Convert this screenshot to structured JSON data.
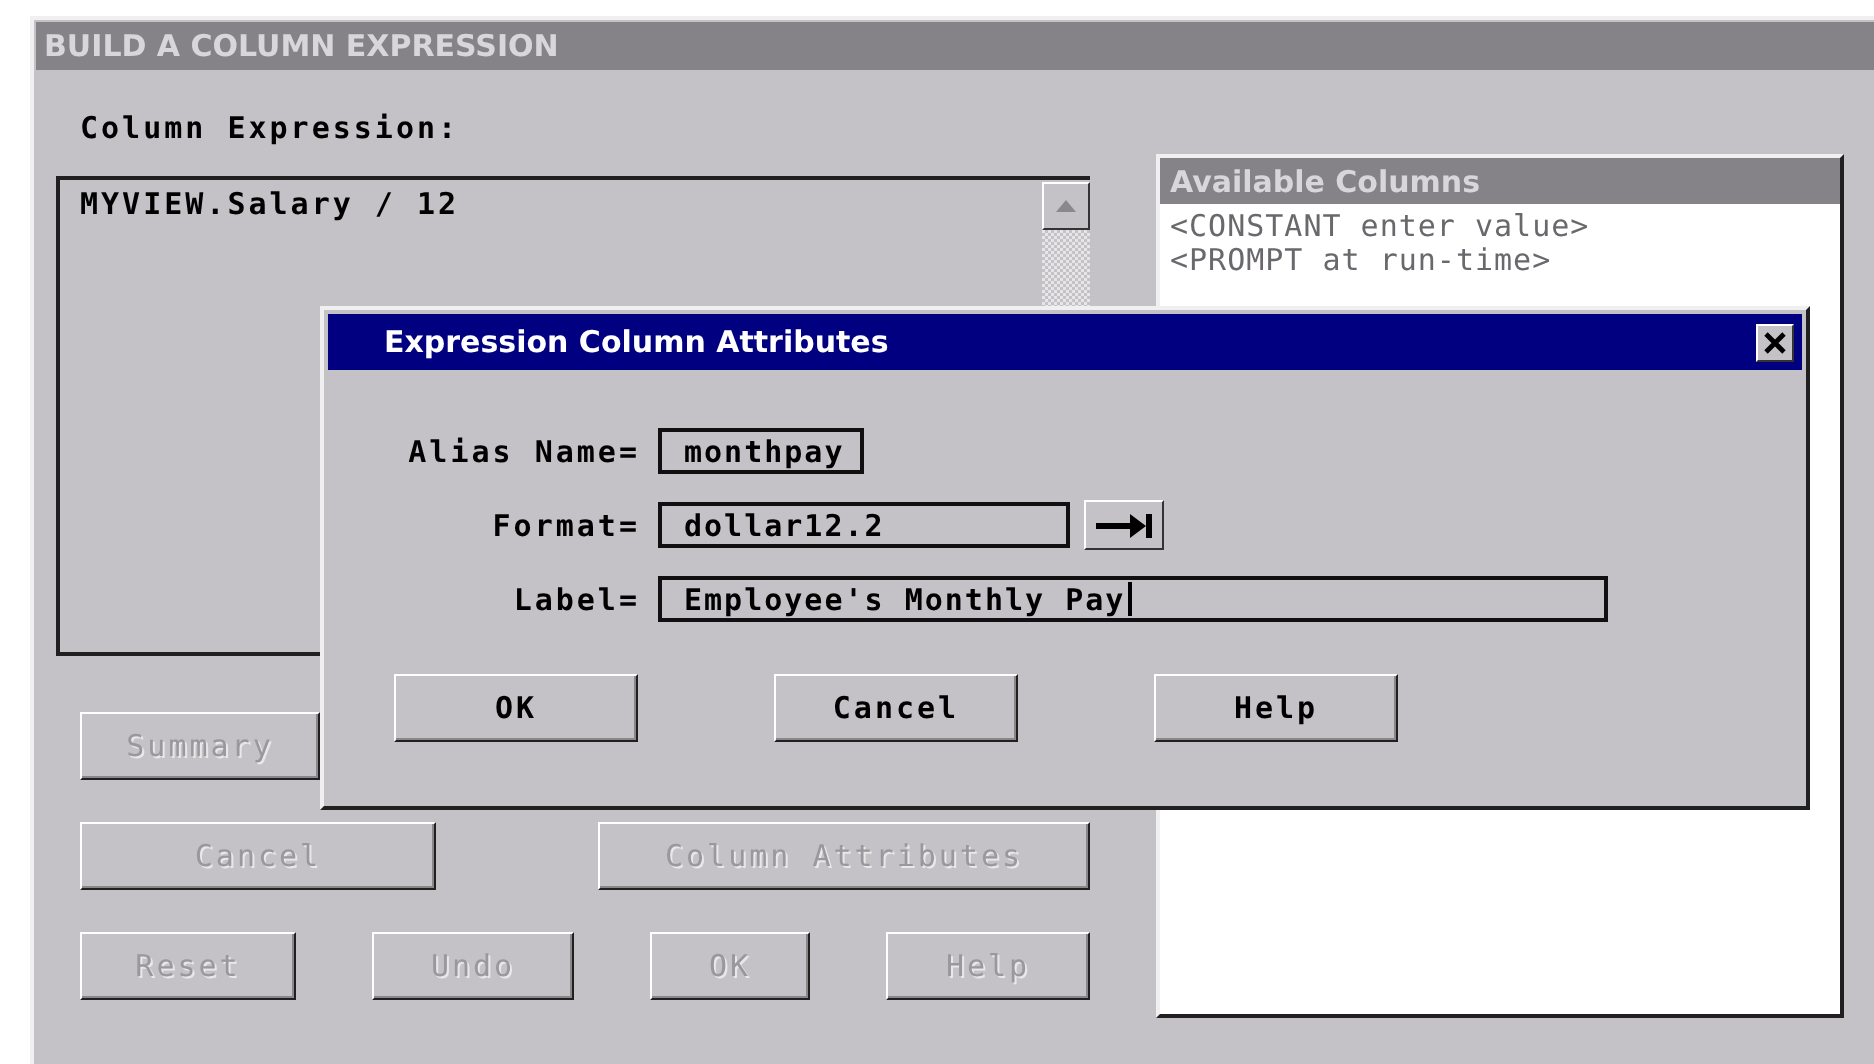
{
  "window": {
    "title": "BUILD A COLUMN EXPRESSION"
  },
  "expression": {
    "label": "Column Expression:",
    "value": "MYVIEW.Salary / 12"
  },
  "button_rows": [
    [
      {
        "label": "Summary",
        "disabled": true
      }
    ],
    [
      {
        "label": "Cancel",
        "disabled": true
      },
      {
        "label": "Column Attributes",
        "disabled": true
      }
    ],
    [
      {
        "label": "Reset",
        "disabled": true
      },
      {
        "label": "Undo",
        "disabled": true
      },
      {
        "label": "OK",
        "disabled": true
      },
      {
        "label": "Help",
        "disabled": true
      }
    ]
  ],
  "available_columns": {
    "title": "Available Columns",
    "items": [
      "<CONSTANT enter value>",
      "<PROMPT at run-time>"
    ]
  },
  "dialog": {
    "title": "Expression Column Attributes",
    "fields": [
      {
        "kind": "text",
        "label": "Alias Name=",
        "value": "monthpay",
        "focused": false
      },
      {
        "kind": "picker",
        "label": "Format=",
        "value": "dollar12.2",
        "focused": false
      },
      {
        "kind": "text",
        "label": "Label=",
        "value": "Employee's Monthly Pay",
        "focused": true
      }
    ],
    "buttons": [
      {
        "label": "OK",
        "disabled": false
      },
      {
        "label": "Cancel",
        "disabled": false
      },
      {
        "label": "Help",
        "disabled": false
      }
    ]
  }
}
